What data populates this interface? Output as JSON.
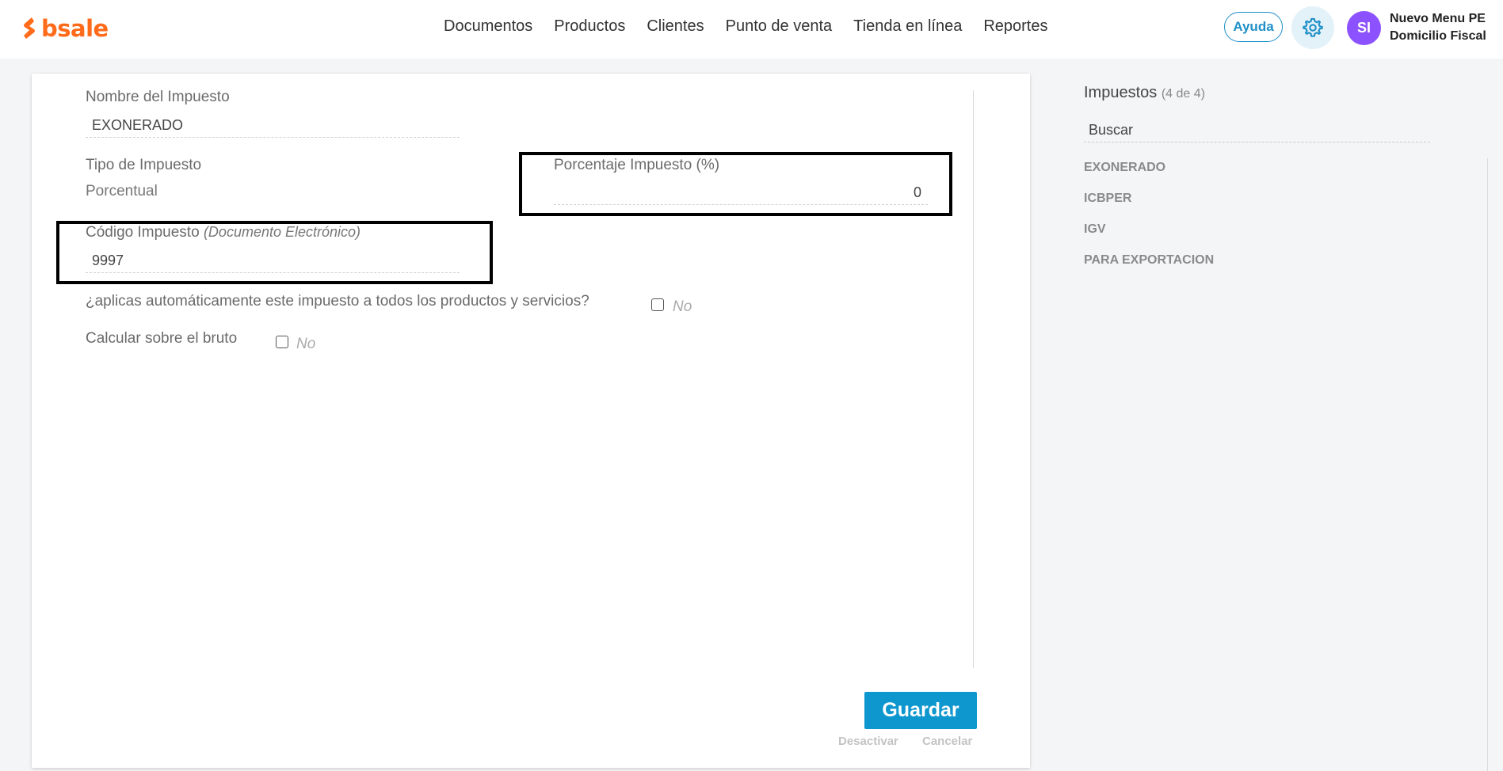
{
  "brand": {
    "name": "bsale",
    "color": "#ff6b1a"
  },
  "nav": {
    "items": [
      {
        "label": "Documentos"
      },
      {
        "label": "Productos"
      },
      {
        "label": "Clientes"
      },
      {
        "label": "Punto de venta"
      },
      {
        "label": "Tienda en línea"
      },
      {
        "label": "Reportes"
      }
    ]
  },
  "header": {
    "help_label": "Ayuda",
    "settings_icon": "gear-icon",
    "avatar_initials": "SI",
    "avatar_color": "#8c52ff",
    "user_line1": "Nuevo Menu PE",
    "user_line2": "Domicilio Fiscal"
  },
  "form": {
    "name_label": "Nombre del Impuesto",
    "name_value": "EXONERADO",
    "type_label": "Tipo de Impuesto",
    "type_value": "Porcentual",
    "percent_label": "Porcentaje Impuesto (%)",
    "percent_value": "0",
    "code_label": "Código Impuesto",
    "code_label_hint": "(Documento Electrónico)",
    "code_value": "9997",
    "auto_apply_label": "¿aplicas automáticamente este impuesto a todos los productos y servicios?",
    "auto_apply_state": "No",
    "gross_label": "Calcular sobre el bruto",
    "gross_state": "No",
    "save_label": "Guardar",
    "deactivate_label": "Desactivar",
    "cancel_label": "Cancelar",
    "accent_color": "#0e97cf"
  },
  "taxes_panel": {
    "title": "Impuestos",
    "count": "(4 de 4)",
    "search_placeholder": "Buscar",
    "items": [
      {
        "label": "EXONERADO"
      },
      {
        "label": "ICBPER"
      },
      {
        "label": "IGV"
      },
      {
        "label": "PARA EXPORTACION"
      }
    ]
  }
}
